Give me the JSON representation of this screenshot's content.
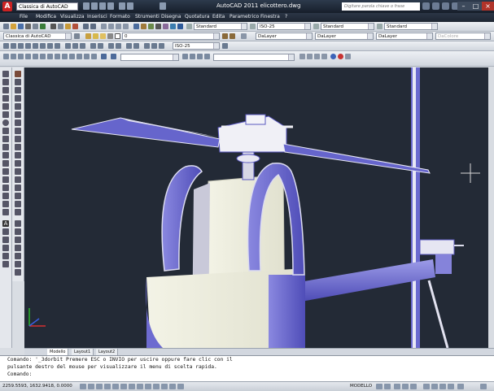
{
  "titlebar": {
    "workspace": "Classica di AutoCAD",
    "title": "AutoCAD 2011   elicottero.dwg",
    "help_placeholder": "Digitare parola chiave o frase"
  },
  "menubar": {
    "items": [
      "File",
      "Modifica",
      "Visualizza",
      "Inserisci",
      "Formato",
      "Strumenti",
      "Disegna",
      "Quotatura",
      "Edita",
      "Parametrico",
      "Finestra",
      "?"
    ]
  },
  "toolbar1": {
    "text_style": "Standard",
    "dim_style": "ISO-25",
    "table_style": "Standard",
    "mleader_style": "Standard"
  },
  "toolbar2": {
    "workspace": "Classica di AutoCAD",
    "layer": "0",
    "color": "DaLayer",
    "linetype": "DaLayer",
    "lineweight": "DaLayer",
    "plotstyle": "DaColore"
  },
  "toolbar3": {
    "dim_style": "ISO-25"
  },
  "layout_tabs": [
    "Modello",
    "Layout1",
    "Layout2"
  ],
  "command": {
    "line1": "Comando: '_3dorbit Premere ESC o INVIO per uscire oppure fare clic con il",
    "line2": "pulsante destro del mouse per visualizzare il menu di scelta rapida.",
    "prompt": "Comando:"
  },
  "status": {
    "coords": "2259.5593, 1632.9418, 0.0000",
    "model": "MODELLO"
  },
  "colors": {
    "viewport_bg": "#232a36",
    "model_fill": "#eeeede",
    "model_shade": "#5553bf"
  }
}
